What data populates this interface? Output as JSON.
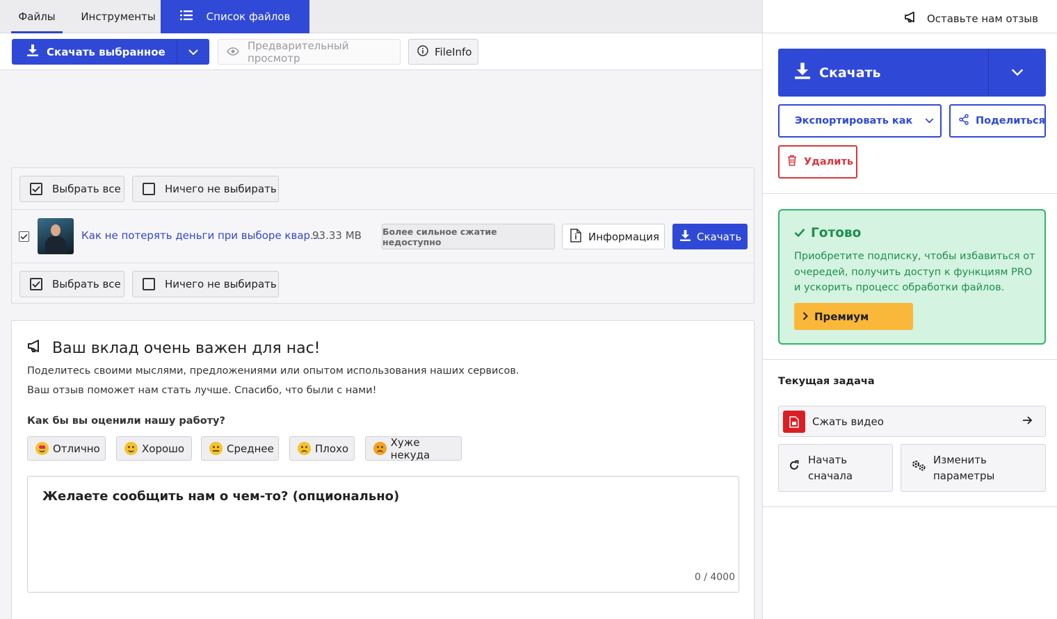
{
  "tabs": {
    "files": "Файлы",
    "tools": "Инструменты",
    "list": "Список файлов"
  },
  "toolbar": {
    "download_selected": "Скачать выбранное",
    "preview": "Предварительный просмотр",
    "fileinfo": "FileInfo"
  },
  "select": {
    "all": "Выбрать все",
    "none": "Ничего не выбирать"
  },
  "file": {
    "name": "Как не потерять деньги при выборе квар...",
    "size": "93.33 MB",
    "compress_badge": "Более сильное сжатие недоступно",
    "info_button": "Информация",
    "download_button": "Скачать"
  },
  "feedback": {
    "title": "Ваш вклад очень важен для нас!",
    "line1": "Поделитесь своими мыслями, предложениями или опытом использования наших сервисов.",
    "line2": "Ваш отзыв поможет нам стать лучше. Спасибо, что были с нами!",
    "question": "Как бы вы оценили нашу работу?",
    "ratings": [
      "Отлично",
      "Хорошо",
      "Среднее",
      "Плохо",
      "Хуже некуда"
    ],
    "textarea_placeholder": "Желаете сообщить нам о чем-то? (опционально)",
    "counter": "0 / 4000"
  },
  "sidebar": {
    "leave_feedback": "Оставьте нам отзыв",
    "download": "Скачать",
    "export_as": "Экспортировать как",
    "share": "Поделиться",
    "delete": "Удалить",
    "ready_title": "Готово",
    "ready_text": "Приобретите подписку, чтобы избавиться от очередей, получить доступ к функциям PRO и ускорить процесс обработки файлов.",
    "premium": "Премиум",
    "current_task_heading": "Текущая задача",
    "current_task": "Сжать видео",
    "restart": "Начать сначала",
    "change_params": "Изменить параметры"
  },
  "colors": {
    "accent": "#2f49d6",
    "success": "#2fb56a",
    "danger": "#d9363e",
    "premium": "#f9b83a"
  }
}
